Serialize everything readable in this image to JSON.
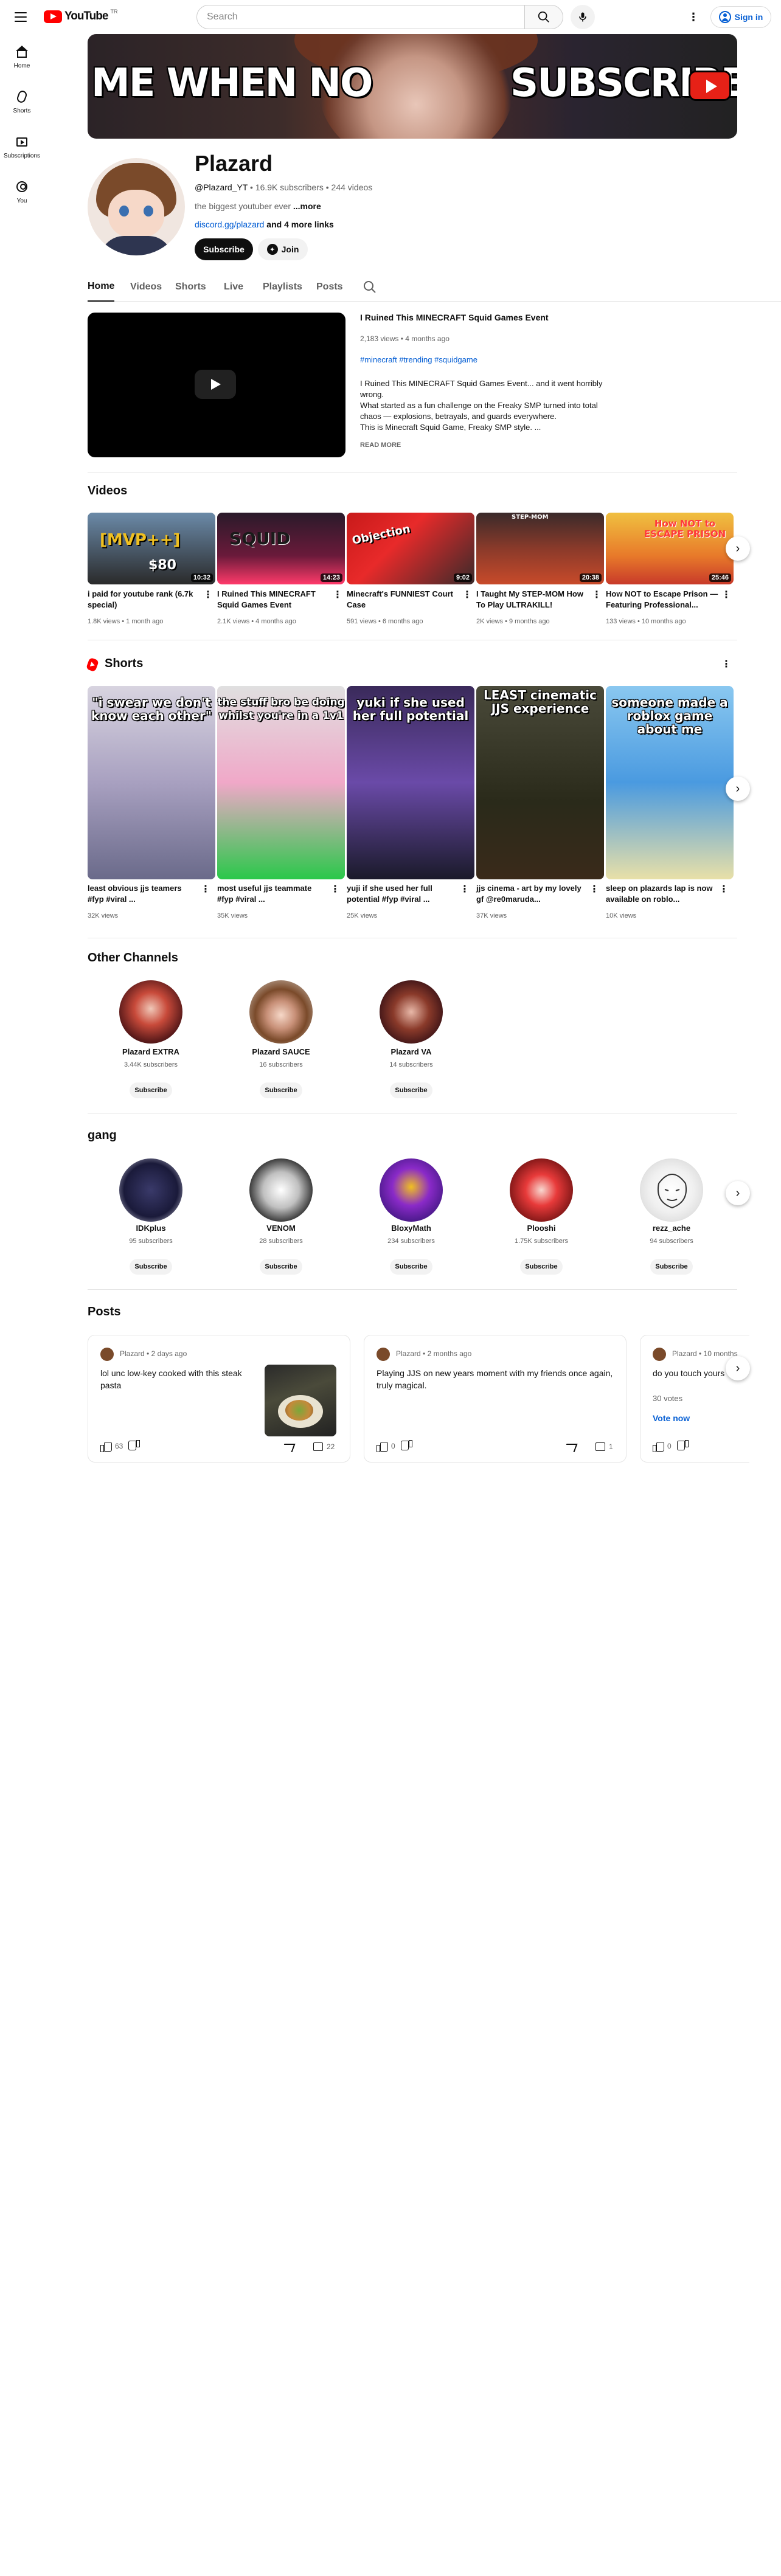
{
  "topbar": {
    "logo_text": "YouTube",
    "logo_sup": "TR",
    "search_placeholder": "Search",
    "signin_label": "Sign in"
  },
  "sidebar": {
    "items": [
      {
        "label": "Home",
        "icon": "home-icon"
      },
      {
        "label": "Shorts",
        "icon": "shorts-icon"
      },
      {
        "label": "Subscriptions",
        "icon": "subscriptions-icon"
      },
      {
        "label": "You",
        "icon": "you-icon"
      }
    ]
  },
  "banner": {
    "text_left": "ME WHEN NO",
    "text_right": "SUBSCRIBE"
  },
  "channel": {
    "name": "Plazard",
    "handle": "@Plazard_YT",
    "subscribers": "16.9K subscribers",
    "videos": "244 videos",
    "description": "the biggest youtuber ever ",
    "more": "...more",
    "link": "discord.gg/plazard",
    "more_links": " and 4 more links",
    "subscribe_label": "Subscribe",
    "join_label": "Join"
  },
  "tabs": [
    "Home",
    "Videos",
    "Shorts",
    "Live",
    "Playlists",
    "Posts"
  ],
  "featured": {
    "title": "I Ruined This MINECRAFT Squid Games Event",
    "meta": "2,183 views • 4 months ago",
    "tags": "#minecraft #trending #squidgame",
    "desc_lines": [
      "I Ruined This MINECRAFT Squid Games Event... and it went horribly wrong.",
      "What started as a fun challenge on the Freaky SMP turned into total chaos — explosions, betrayals, and guards everywhere.",
      "This is Minecraft Squid Game, Freaky SMP style. ..."
    ],
    "read_more": "READ MORE"
  },
  "videos_section": {
    "title": "Videos",
    "items": [
      {
        "title": "i paid for youtube rank (6.7k special)",
        "meta": "1.8K views • 1 month ago",
        "duration": "10:32",
        "thumb_text": "[MVP++]",
        "thumb_sub": "$80"
      },
      {
        "title": "I Ruined This MINECRAFT Squid Games Event",
        "meta": "2.1K views • 4 months ago",
        "duration": "14:23",
        "thumb_text": "SQUID"
      },
      {
        "title": "Minecraft's FUNNIEST Court Case",
        "meta": "591 views • 6 months ago",
        "duration": "9:02",
        "thumb_text": "Objection"
      },
      {
        "title": "I Taught My STEP-MOM How To Play ULTRAKILL!",
        "meta": "2K views • 9 months ago",
        "duration": "20:38",
        "thumb_text": "STEP-MOM"
      },
      {
        "title": "How NOT to Escape Prison — Featuring Professional...",
        "meta": "133 views • 10 months ago",
        "duration": "25:46",
        "thumb_text": "How NOT to ESCAPE PRISON"
      }
    ]
  },
  "shorts_section": {
    "title": "Shorts",
    "items": [
      {
        "title": "least obvious jjs teamers #fyp #viral ...",
        "views": "32K views",
        "thumb_text": "\"i swear we don't know each other\""
      },
      {
        "title": "most useful jjs teammate #fyp #viral ...",
        "views": "35K views",
        "thumb_text": "the stuff bro be doing whilst you're in a 1v1"
      },
      {
        "title": "yuji if she used her full potential #fyp #viral ...",
        "views": "25K views",
        "thumb_text": "yuki if she used her full potential"
      },
      {
        "title": "jjs cinema - art by my lovely gf @re0maruda...",
        "views": "37K views",
        "thumb_text": "LEAST cinematic JJS experience"
      },
      {
        "title": "sleep on plazards lap is now available on roblo...",
        "views": "10K views",
        "thumb_text": "someone made a roblox game about me"
      }
    ]
  },
  "other_channels": {
    "title": "Other Channels",
    "items": [
      {
        "name": "Plazard EXTRA",
        "subs": "3.44K subscribers",
        "btn": "Subscribe"
      },
      {
        "name": "Plazard SAUCE",
        "subs": "16 subscribers",
        "btn": "Subscribe"
      },
      {
        "name": "Plazard VA",
        "subs": "14 subscribers",
        "btn": "Subscribe"
      }
    ]
  },
  "gang": {
    "title": "gang",
    "items": [
      {
        "name": "IDKplus",
        "subs": "95 subscribers",
        "btn": "Subscribe"
      },
      {
        "name": "VENOM",
        "subs": "28 subscribers",
        "btn": "Subscribe"
      },
      {
        "name": "BloxyMath",
        "subs": "234 subscribers",
        "btn": "Subscribe"
      },
      {
        "name": "Plooshi",
        "subs": "1.75K subscribers",
        "btn": "Subscribe"
      },
      {
        "name": "rezz_ache",
        "subs": "94 subscribers",
        "btn": "Subscribe"
      }
    ]
  },
  "posts": {
    "title": "Posts",
    "items": [
      {
        "author": "Plazard • 2 days ago",
        "text": "lol unc low-key cooked with this steak pasta",
        "likes": "63",
        "comments": "22"
      },
      {
        "author": "Plazard • 2 months ago",
        "text": "Playing JJS on new years moment with my friends once again, truly magical.",
        "likes": "0",
        "comments": "1"
      },
      {
        "author": "Plazard • 10 months",
        "text": "do you touch yours",
        "votes": "30 votes",
        "vote_label": "Vote now",
        "likes": "0"
      }
    ]
  },
  "colors": {
    "brand_red": "#ff0000",
    "link_blue": "#065fd4",
    "text_primary": "#0f0f0f",
    "text_secondary": "#606060"
  }
}
